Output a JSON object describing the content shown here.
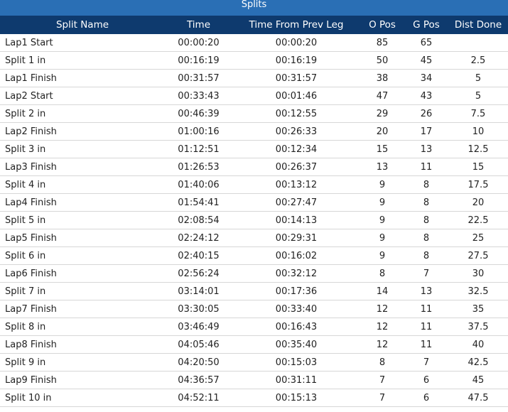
{
  "title": "Splits",
  "columns": [
    "Split Name",
    "Time",
    "Time From Prev Leg",
    "O Pos",
    "G Pos",
    "Dist Done"
  ],
  "rows": [
    [
      "Lap1 Start",
      "00:00:20",
      "00:00:20",
      "85",
      "65",
      ""
    ],
    [
      "Split 1 in",
      "00:16:19",
      "00:16:19",
      "50",
      "45",
      "2.5"
    ],
    [
      "Lap1 Finish",
      "00:31:57",
      "00:31:57",
      "38",
      "34",
      "5"
    ],
    [
      "Lap2 Start",
      "00:33:43",
      "00:01:46",
      "47",
      "43",
      "5"
    ],
    [
      "Split 2 in",
      "00:46:39",
      "00:12:55",
      "29",
      "26",
      "7.5"
    ],
    [
      "Lap2 Finish",
      "01:00:16",
      "00:26:33",
      "20",
      "17",
      "10"
    ],
    [
      "Split 3 in",
      "01:12:51",
      "00:12:34",
      "15",
      "13",
      "12.5"
    ],
    [
      "Lap3 Finish",
      "01:26:53",
      "00:26:37",
      "13",
      "11",
      "15"
    ],
    [
      "Split 4 in",
      "01:40:06",
      "00:13:12",
      "9",
      "8",
      "17.5"
    ],
    [
      "Lap4 Finish",
      "01:54:41",
      "00:27:47",
      "9",
      "8",
      "20"
    ],
    [
      "Split 5 in",
      "02:08:54",
      "00:14:13",
      "9",
      "8",
      "22.5"
    ],
    [
      "Lap5 Finish",
      "02:24:12",
      "00:29:31",
      "9",
      "8",
      "25"
    ],
    [
      "Split 6 in",
      "02:40:15",
      "00:16:02",
      "9",
      "8",
      "27.5"
    ],
    [
      "Lap6 Finish",
      "02:56:24",
      "00:32:12",
      "8",
      "7",
      "30"
    ],
    [
      "Split 7 in",
      "03:14:01",
      "00:17:36",
      "14",
      "13",
      "32.5"
    ],
    [
      "Lap7 Finish",
      "03:30:05",
      "00:33:40",
      "12",
      "11",
      "35"
    ],
    [
      "Split 8 in",
      "03:46:49",
      "00:16:43",
      "12",
      "11",
      "37.5"
    ],
    [
      "Lap8 Finish",
      "04:05:46",
      "00:35:40",
      "12",
      "11",
      "40"
    ],
    [
      "Split 9 in",
      "04:20:50",
      "00:15:03",
      "8",
      "7",
      "42.5"
    ],
    [
      "Lap9 Finish",
      "04:36:57",
      "00:31:11",
      "7",
      "6",
      "45"
    ],
    [
      "Split 10 in",
      "04:52:11",
      "00:15:13",
      "7",
      "6",
      "47.5"
    ]
  ],
  "colors": {
    "title_bar": "#2a6fb5",
    "header": "#0e3a6e",
    "row_border": "#d7d7d7",
    "text": "#222222"
  }
}
